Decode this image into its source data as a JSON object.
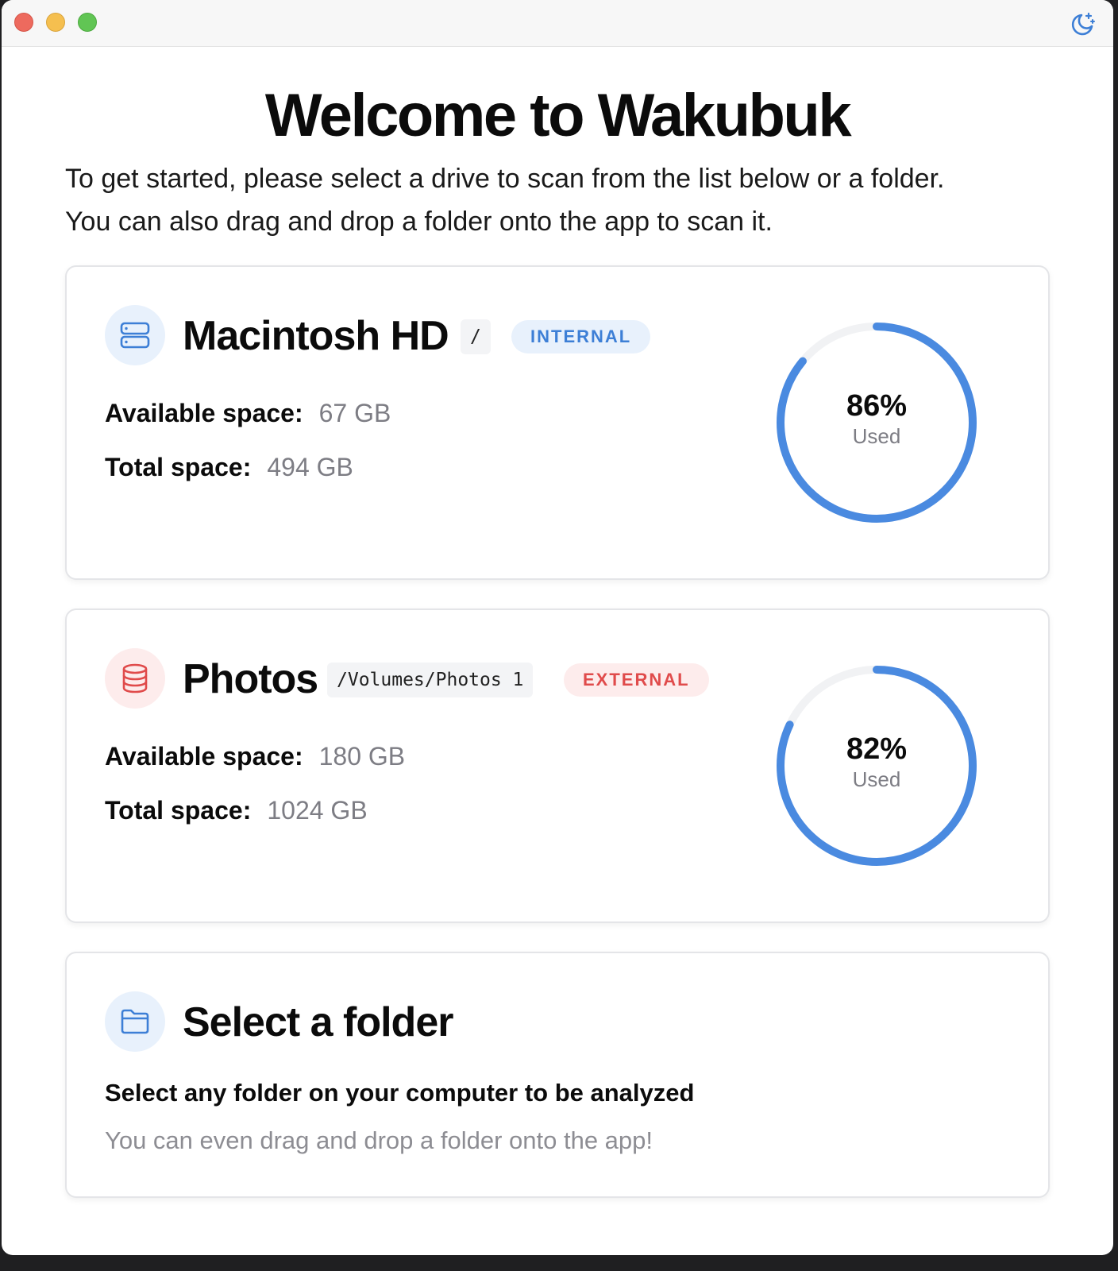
{
  "window": {
    "colors": {
      "accent": "#4a8ae0",
      "internal": "#3d7fd6",
      "external": "#e04b4b"
    },
    "theme_toggle_icon": "moon-stars-icon"
  },
  "welcome": {
    "title": "Welcome to Wakubuk",
    "intro_line1": "To get started, please select a drive to scan from the list below or a folder.",
    "intro_line2": "You can also drag and drop a folder onto the app to scan it."
  },
  "drives": [
    {
      "name": "Macintosh HD",
      "path": "/",
      "badge": "INTERNAL",
      "icon": "server-icon",
      "available_label": "Available space:",
      "available_value": "67 GB",
      "total_label": "Total space:",
      "total_value": "494 GB",
      "used_percent": 86,
      "used_percent_label": "86%",
      "used_label": "Used"
    },
    {
      "name": "Photos",
      "path": "/Volumes/Photos 1",
      "badge": "EXTERNAL",
      "icon": "database-icon",
      "available_label": "Available space:",
      "available_value": "180 GB",
      "total_label": "Total space:",
      "total_value": "1024 GB",
      "used_percent": 82,
      "used_percent_label": "82%",
      "used_label": "Used"
    }
  ],
  "folder_card": {
    "title": "Select a folder",
    "icon": "folder-icon",
    "subtitle": "Select any folder on your computer to be analyzed",
    "hint": "You can even drag and drop a folder onto the app!"
  }
}
